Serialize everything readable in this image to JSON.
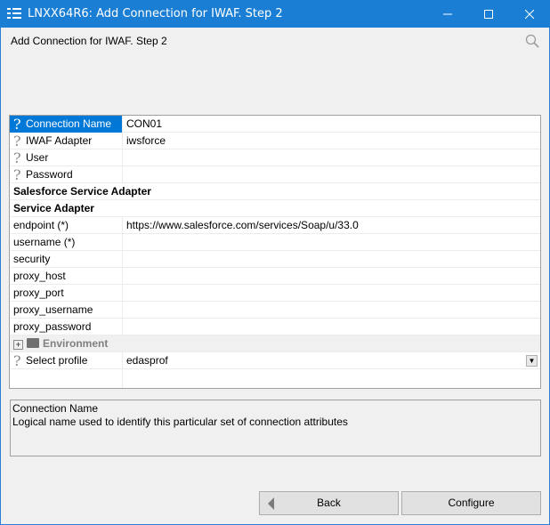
{
  "window": {
    "title": "LNXX64R6: Add Connection for IWAF. Step 2",
    "minimize": "—",
    "maximize": "☐",
    "close": "✕"
  },
  "header": {
    "step_title": "Add Connection for IWAF. Step 2"
  },
  "grid": {
    "rows": [
      {
        "name": "Connection Name",
        "value": "CON01"
      },
      {
        "name": "IWAF Adapter",
        "value": "iwsforce"
      },
      {
        "name": "User",
        "value": ""
      },
      {
        "name": "Password",
        "value": ""
      },
      {
        "name": "Salesforce Service Adapter",
        "value": ""
      },
      {
        "name": "Service Adapter",
        "value": ""
      },
      {
        "name": "endpoint (*)",
        "value": "https://www.salesforce.com/services/Soap/u/33.0"
      },
      {
        "name": "username (*)",
        "value": ""
      },
      {
        "name": "security",
        "value": ""
      },
      {
        "name": "proxy_host",
        "value": ""
      },
      {
        "name": "proxy_port",
        "value": ""
      },
      {
        "name": "proxy_username",
        "value": ""
      },
      {
        "name": "proxy_password",
        "value": ""
      },
      {
        "name": "Environment",
        "value": ""
      },
      {
        "name": "Select profile",
        "value": "edasprof"
      }
    ]
  },
  "description": {
    "title": "Connection Name",
    "text": "Logical name used to identify this particular set of connection attributes"
  },
  "buttons": {
    "back": "Back",
    "configure": "Configure"
  },
  "colors": {
    "titlebar": "#1a7fd4",
    "selection": "#0078d7"
  }
}
